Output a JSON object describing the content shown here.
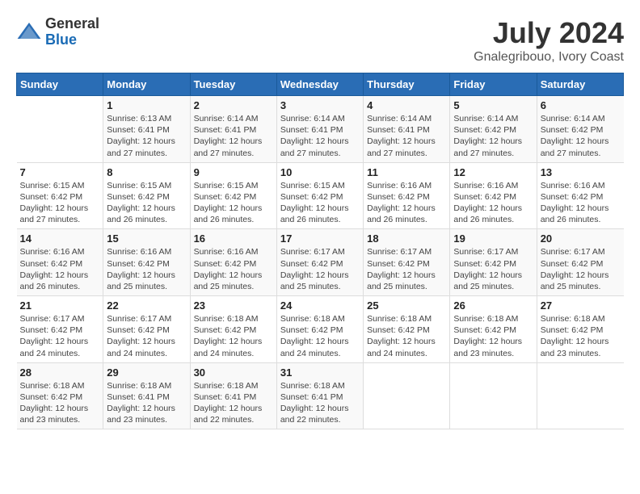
{
  "logo": {
    "general": "General",
    "blue": "Blue"
  },
  "title": {
    "month_year": "July 2024",
    "location": "Gnalegribouo, Ivory Coast"
  },
  "days_of_week": [
    "Sunday",
    "Monday",
    "Tuesday",
    "Wednesday",
    "Thursday",
    "Friday",
    "Saturday"
  ],
  "weeks": [
    [
      {
        "day": "",
        "info": ""
      },
      {
        "day": "1",
        "info": "Sunrise: 6:13 AM\nSunset: 6:41 PM\nDaylight: 12 hours and 27 minutes."
      },
      {
        "day": "2",
        "info": "Sunrise: 6:14 AM\nSunset: 6:41 PM\nDaylight: 12 hours and 27 minutes."
      },
      {
        "day": "3",
        "info": "Sunrise: 6:14 AM\nSunset: 6:41 PM\nDaylight: 12 hours and 27 minutes."
      },
      {
        "day": "4",
        "info": "Sunrise: 6:14 AM\nSunset: 6:41 PM\nDaylight: 12 hours and 27 minutes."
      },
      {
        "day": "5",
        "info": "Sunrise: 6:14 AM\nSunset: 6:42 PM\nDaylight: 12 hours and 27 minutes."
      },
      {
        "day": "6",
        "info": "Sunrise: 6:14 AM\nSunset: 6:42 PM\nDaylight: 12 hours and 27 minutes."
      }
    ],
    [
      {
        "day": "7",
        "info": "Sunrise: 6:15 AM\nSunset: 6:42 PM\nDaylight: 12 hours and 27 minutes."
      },
      {
        "day": "8",
        "info": "Sunrise: 6:15 AM\nSunset: 6:42 PM\nDaylight: 12 hours and 26 minutes."
      },
      {
        "day": "9",
        "info": "Sunrise: 6:15 AM\nSunset: 6:42 PM\nDaylight: 12 hours and 26 minutes."
      },
      {
        "day": "10",
        "info": "Sunrise: 6:15 AM\nSunset: 6:42 PM\nDaylight: 12 hours and 26 minutes."
      },
      {
        "day": "11",
        "info": "Sunrise: 6:16 AM\nSunset: 6:42 PM\nDaylight: 12 hours and 26 minutes."
      },
      {
        "day": "12",
        "info": "Sunrise: 6:16 AM\nSunset: 6:42 PM\nDaylight: 12 hours and 26 minutes."
      },
      {
        "day": "13",
        "info": "Sunrise: 6:16 AM\nSunset: 6:42 PM\nDaylight: 12 hours and 26 minutes."
      }
    ],
    [
      {
        "day": "14",
        "info": "Sunrise: 6:16 AM\nSunset: 6:42 PM\nDaylight: 12 hours and 26 minutes."
      },
      {
        "day": "15",
        "info": "Sunrise: 6:16 AM\nSunset: 6:42 PM\nDaylight: 12 hours and 25 minutes."
      },
      {
        "day": "16",
        "info": "Sunrise: 6:16 AM\nSunset: 6:42 PM\nDaylight: 12 hours and 25 minutes."
      },
      {
        "day": "17",
        "info": "Sunrise: 6:17 AM\nSunset: 6:42 PM\nDaylight: 12 hours and 25 minutes."
      },
      {
        "day": "18",
        "info": "Sunrise: 6:17 AM\nSunset: 6:42 PM\nDaylight: 12 hours and 25 minutes."
      },
      {
        "day": "19",
        "info": "Sunrise: 6:17 AM\nSunset: 6:42 PM\nDaylight: 12 hours and 25 minutes."
      },
      {
        "day": "20",
        "info": "Sunrise: 6:17 AM\nSunset: 6:42 PM\nDaylight: 12 hours and 25 minutes."
      }
    ],
    [
      {
        "day": "21",
        "info": "Sunrise: 6:17 AM\nSunset: 6:42 PM\nDaylight: 12 hours and 24 minutes."
      },
      {
        "day": "22",
        "info": "Sunrise: 6:17 AM\nSunset: 6:42 PM\nDaylight: 12 hours and 24 minutes."
      },
      {
        "day": "23",
        "info": "Sunrise: 6:18 AM\nSunset: 6:42 PM\nDaylight: 12 hours and 24 minutes."
      },
      {
        "day": "24",
        "info": "Sunrise: 6:18 AM\nSunset: 6:42 PM\nDaylight: 12 hours and 24 minutes."
      },
      {
        "day": "25",
        "info": "Sunrise: 6:18 AM\nSunset: 6:42 PM\nDaylight: 12 hours and 24 minutes."
      },
      {
        "day": "26",
        "info": "Sunrise: 6:18 AM\nSunset: 6:42 PM\nDaylight: 12 hours and 23 minutes."
      },
      {
        "day": "27",
        "info": "Sunrise: 6:18 AM\nSunset: 6:42 PM\nDaylight: 12 hours and 23 minutes."
      }
    ],
    [
      {
        "day": "28",
        "info": "Sunrise: 6:18 AM\nSunset: 6:42 PM\nDaylight: 12 hours and 23 minutes."
      },
      {
        "day": "29",
        "info": "Sunrise: 6:18 AM\nSunset: 6:41 PM\nDaylight: 12 hours and 23 minutes."
      },
      {
        "day": "30",
        "info": "Sunrise: 6:18 AM\nSunset: 6:41 PM\nDaylight: 12 hours and 22 minutes."
      },
      {
        "day": "31",
        "info": "Sunrise: 6:18 AM\nSunset: 6:41 PM\nDaylight: 12 hours and 22 minutes."
      },
      {
        "day": "",
        "info": ""
      },
      {
        "day": "",
        "info": ""
      },
      {
        "day": "",
        "info": ""
      }
    ]
  ]
}
